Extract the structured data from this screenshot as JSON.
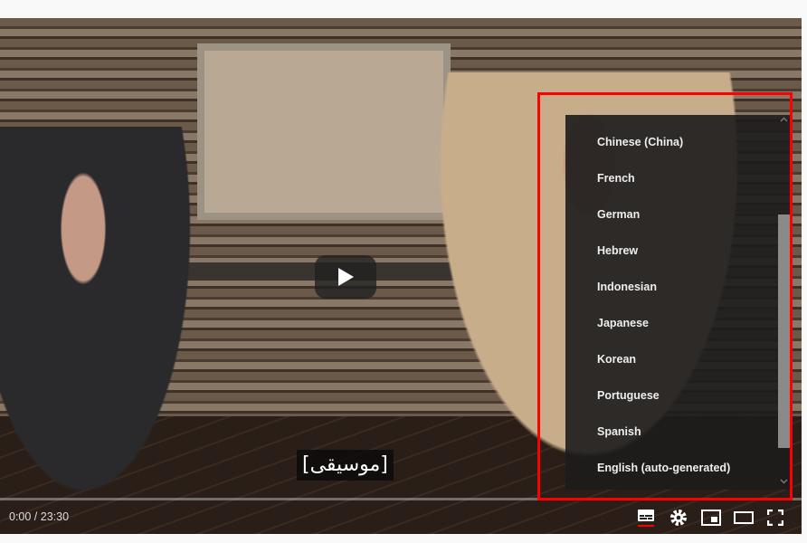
{
  "player": {
    "caption": "[موسيقى]",
    "time": "0:00 / 23:30",
    "progress_percent": 0
  },
  "subtitle_menu": {
    "items": [
      "Chinese (China)",
      "French",
      "German",
      "Hebrew",
      "Indonesian",
      "Japanese",
      "Korean",
      "Portuguese",
      "Spanish",
      "English (auto-generated)"
    ]
  },
  "controls": {
    "icons": [
      "subtitles-icon",
      "settings-icon",
      "miniplayer-icon",
      "theater-mode-icon",
      "fullscreen-icon"
    ],
    "subtitles_active_color": "#ff0000"
  },
  "highlight_color": "#ff0000"
}
